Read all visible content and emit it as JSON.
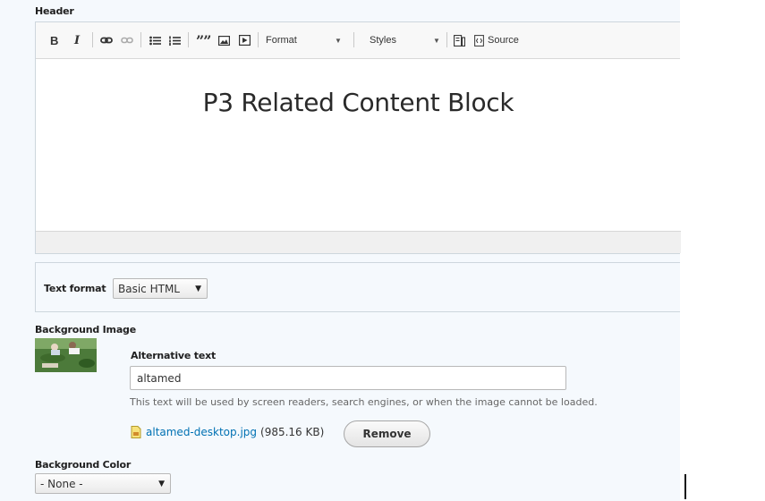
{
  "header": {
    "label": "Header",
    "toolbar": {
      "bold": "B",
      "italic": "I",
      "blockquote": "””",
      "format_label": "Format",
      "styles_label": "Styles",
      "source_label": "Source"
    },
    "content_heading": "P3 Related Content Block"
  },
  "text_format": {
    "label": "Text format",
    "selected": "Basic HTML"
  },
  "background_image": {
    "label": "Background Image",
    "alt_label": "Alternative text",
    "alt_value": "altamed",
    "alt_description": "This text will be used by screen readers, search engines, or when the image cannot be loaded.",
    "file_name": "altamed-desktop.jpg",
    "file_size": "(985.16 KB)",
    "remove_label": "Remove"
  },
  "background_color": {
    "label": "Background Color",
    "selected": "- None -"
  },
  "icons": [
    "bold-icon",
    "italic-icon",
    "link-icon",
    "unlink-icon",
    "bulleted-list-icon",
    "numbered-list-icon",
    "blockquote-icon",
    "image-icon",
    "media-icon",
    "template-icon",
    "source-icon",
    "file-icon"
  ]
}
